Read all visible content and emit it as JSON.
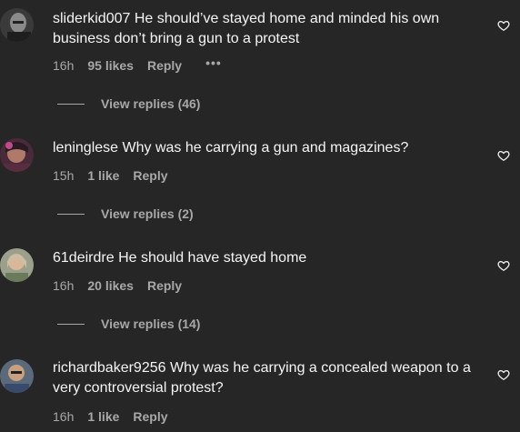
{
  "comments": [
    {
      "username": "sliderkid007",
      "text": "He should’ve stayed home and minded his own business don’t bring a gun to a protest",
      "time": "16h",
      "likes": "95 likes",
      "reply": "Reply",
      "more": "•••",
      "view_replies": "View replies (46)"
    },
    {
      "username": "leninglese",
      "text": "Why was he carrying a gun and magazines?",
      "time": "15h",
      "likes": "1 like",
      "reply": "Reply",
      "view_replies": "View replies (2)"
    },
    {
      "username": "61deirdre",
      "text": "He should have stayed home",
      "time": "16h",
      "likes": "20 likes",
      "reply": "Reply",
      "view_replies": "View replies (14)"
    },
    {
      "username": "richardbaker9256",
      "text": "Why was he carrying a concealed weapon to a very controversial protest?",
      "time": "16h",
      "likes": "1 like",
      "reply": "Reply"
    }
  ],
  "colors": {
    "background": "#262626",
    "text_primary": "#f5f5f5",
    "text_secondary": "#a8a8a8"
  },
  "icons": {
    "like": "heart-outline-icon",
    "more": "more-options-icon"
  }
}
